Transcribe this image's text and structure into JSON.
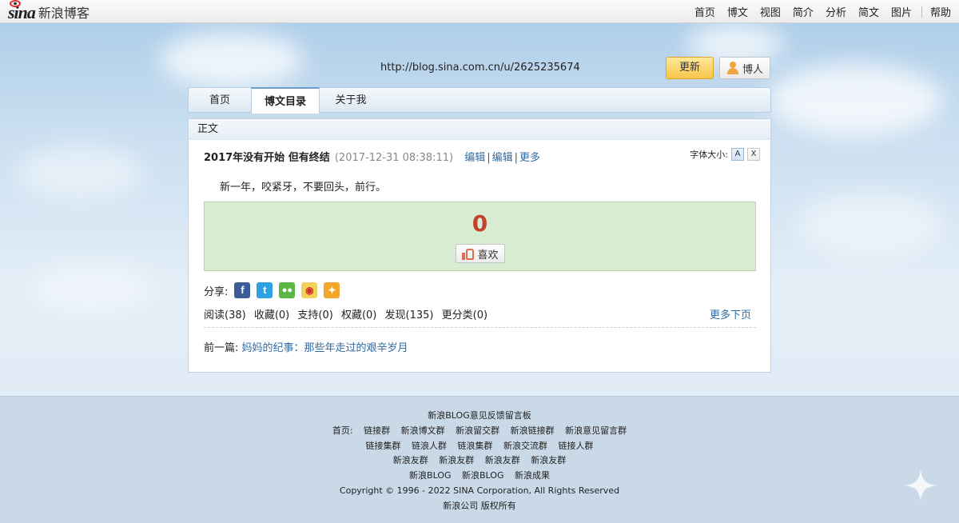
{
  "topbar": {
    "logo_sina": "sina",
    "logo_text": "新浪博客",
    "nav": [
      "首页",
      "博文",
      "视图",
      "简介",
      "分析",
      "简文",
      "图片"
    ],
    "help": "帮助"
  },
  "header": {
    "url": "http://blog.sina.com.cn/u/2625235674",
    "update_button": "更新",
    "person_button": "博人"
  },
  "tabs": {
    "home": "首页",
    "list": "博文目录",
    "about": "关于我"
  },
  "panel": {
    "head": "正文",
    "title": "2017年没有开始 但有终结",
    "time": "(2017-12-31 08:38:11)",
    "action_edit_1": "编辑",
    "action_edit_2": "编辑",
    "action_more": "更多",
    "fontsize_label": "字体大小:",
    "fontsize_a": "A",
    "fontsize_x": "X",
    "body": "新一年，咬紧牙，不要回头，前行。",
    "like_count": "0",
    "like_label": "喜欢",
    "share_label": "分享:",
    "share_icons": [
      "facebook-icon",
      "twitter-icon",
      "wechat-icon",
      "weibo-icon",
      "qzone-icon"
    ],
    "stats": [
      "阅读(38)",
      "收藏(0)",
      "支持(0)",
      "权藏(0)",
      "发现(135)",
      "更分类(0)"
    ],
    "more_next": "更多下页",
    "prev_label": "前一篇:",
    "prev_link": "妈妈的纪事：那些年走过的艰辛岁月"
  },
  "footer": {
    "line1": "新浪BLOG意见反馈留言板",
    "line2": [
      "首页:",
      "链接群",
      "新浪博文群",
      "新浪留交群",
      "新浪链接群",
      "新浪意见留言群"
    ],
    "line3": [
      "链接集群",
      "链浪人群",
      "链浪集群",
      "新浪交流群",
      "链接人群"
    ],
    "line4": [
      "新浪友群",
      "新浪友群",
      "新浪友群",
      "新浪友群"
    ],
    "line5": [
      "新浪BLOG",
      "新浪BLOG",
      "新浪成果"
    ],
    "copyright": "Copyright © 1996 - 2022 SINA Corporation, All Rights Reserved",
    "rights": "新浪公司 版权所有"
  },
  "colors": {
    "link": "#2f6aa3",
    "like_count": "#c4412b",
    "like_box_bg": "#d8ecd2",
    "update_button_bg": "#f9c64a"
  }
}
